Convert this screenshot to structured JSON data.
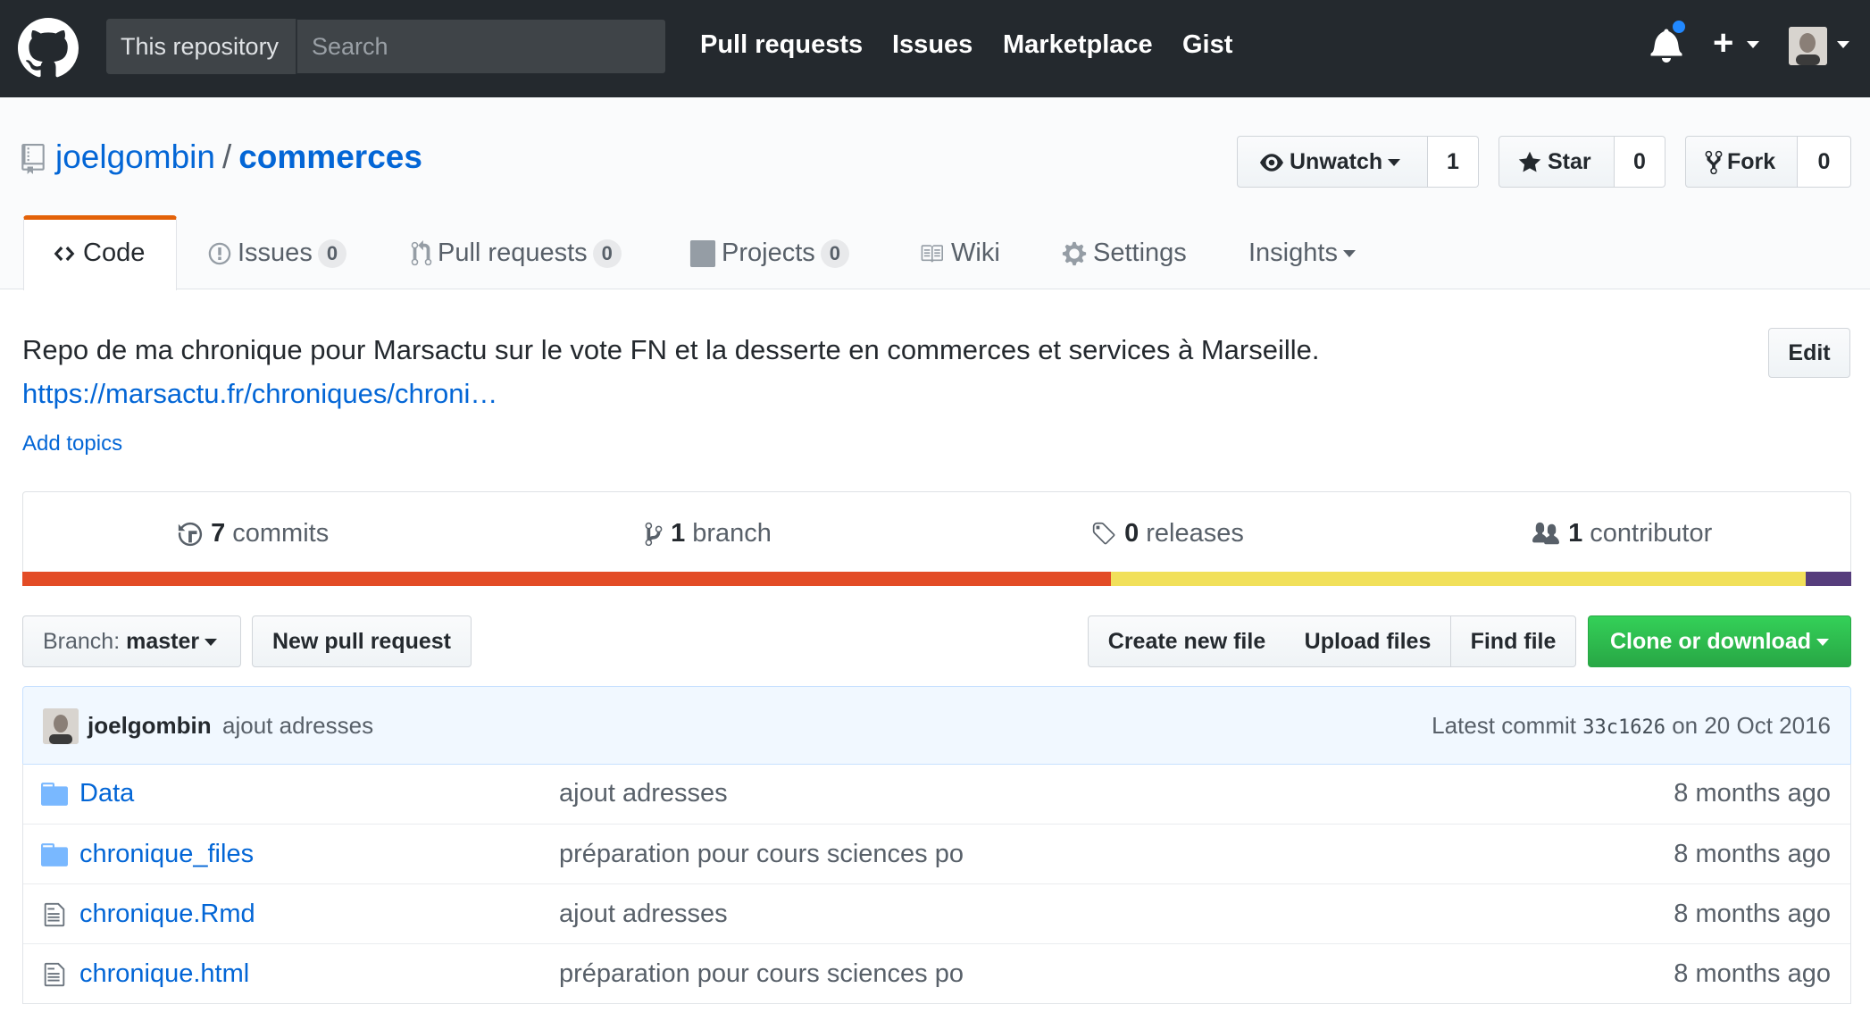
{
  "header": {
    "scope_label": "This repository",
    "search_placeholder": "Search",
    "nav": [
      "Pull requests",
      "Issues",
      "Marketplace",
      "Gist"
    ],
    "plus_label": "+"
  },
  "repo": {
    "owner": "joelgombin",
    "separator": "/",
    "name": "commerces",
    "watch_label": "Unwatch",
    "watch_count": "1",
    "star_label": "Star",
    "star_count": "0",
    "fork_label": "Fork",
    "fork_count": "0"
  },
  "tabs": [
    {
      "label": "Code",
      "icon": "code-icon"
    },
    {
      "label": "Issues",
      "count": "0",
      "icon": "issue-icon"
    },
    {
      "label": "Pull requests",
      "count": "0",
      "icon": "pull-request-icon"
    },
    {
      "label": "Projects",
      "count": "0",
      "icon": "project-icon"
    },
    {
      "label": "Wiki",
      "icon": "book-icon"
    },
    {
      "label": "Settings",
      "icon": "gear-icon"
    },
    {
      "label": "Insights",
      "icon": "chevron-down-icon"
    }
  ],
  "about": {
    "description": "Repo de ma chronique pour Marsactu sur le vote FN et la desserte en commerces et services à Marseille.",
    "homepage": "https://marsactu.fr/chroniques/chroni…",
    "add_topics": "Add topics",
    "edit_label": "Edit"
  },
  "summary": {
    "commits_count": "7",
    "commits_label": "commits",
    "branch_count": "1",
    "branch_label": "branch",
    "releases_count": "0",
    "releases_label": "releases",
    "contributor_count": "1",
    "contributor_label": "contributor"
  },
  "language_colors": {
    "lang1": {
      "color": "#e34c26",
      "fraction": 0.595
    },
    "lang2": {
      "color": "#f1e05a",
      "fraction": 0.38
    },
    "lang3": {
      "color": "#563d7c",
      "fraction": 0.025
    }
  },
  "file_nav": {
    "branch_prefix": "Branch:",
    "branch_name": "master",
    "new_pr": "New pull request",
    "create_file": "Create new file",
    "upload_files": "Upload files",
    "find_file": "Find file",
    "clone": "Clone or download"
  },
  "latest_commit": {
    "author": "joelgombin",
    "message": "ajout adresses",
    "prefix": "Latest commit",
    "sha": "33c1626",
    "date": "on 20 Oct 2016"
  },
  "files": [
    {
      "type": "dir",
      "icon": "folder-icon",
      "name": "Data",
      "message": "ajout adresses",
      "age": "8 months ago"
    },
    {
      "type": "dir",
      "icon": "folder-icon",
      "name": "chronique_files",
      "message": "préparation pour cours sciences po",
      "age": "8 months ago"
    },
    {
      "type": "file",
      "icon": "file-icon",
      "name": "chronique.Rmd",
      "message": "ajout adresses",
      "age": "8 months ago"
    },
    {
      "type": "file",
      "icon": "file-icon",
      "name": "chronique.html",
      "message": "préparation pour cours sciences po",
      "age": "8 months ago"
    }
  ]
}
